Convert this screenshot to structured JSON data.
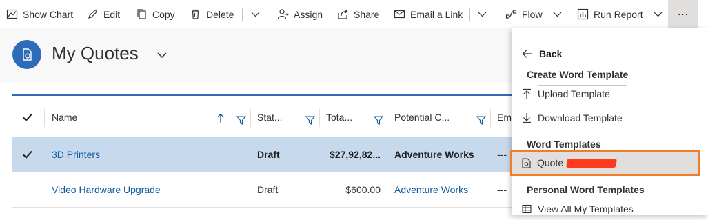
{
  "toolbar": {
    "show_chart": "Show Chart",
    "edit": "Edit",
    "copy": "Copy",
    "delete": "Delete",
    "assign": "Assign",
    "share": "Share",
    "email_link": "Email a Link",
    "flow": "Flow",
    "run_report": "Run Report",
    "more": "⋯"
  },
  "page": {
    "title": "My Quotes"
  },
  "grid": {
    "columns": [
      "Name",
      "Stat...",
      "Tota...",
      "Potential C...",
      "Ema"
    ],
    "rows": [
      {
        "name": "3D Printers",
        "status": "Draft",
        "total": "$27,92,82...",
        "potential_customer": "Adventure Works",
        "email": "---",
        "selected": true
      },
      {
        "name": "Video Hardware Upgrade",
        "status": "Draft",
        "total": "$600.00",
        "potential_customer": "Adventure Works",
        "email": "---",
        "selected": false
      }
    ]
  },
  "menu": {
    "back": "Back",
    "create_section": "Create Word Template",
    "upload": "Upload Template",
    "download": "Download Template",
    "word_section": "Word Templates",
    "quote_item": "Quote",
    "personal_section": "Personal Word Templates",
    "view_all": "View All My Templates"
  },
  "colors": {
    "accent": "#2e6bb8",
    "link": "#0f5a9e",
    "selected_row": "#c7d9ec",
    "highlight_outline": "#f07d29",
    "redaction": "#ff3a1f"
  }
}
